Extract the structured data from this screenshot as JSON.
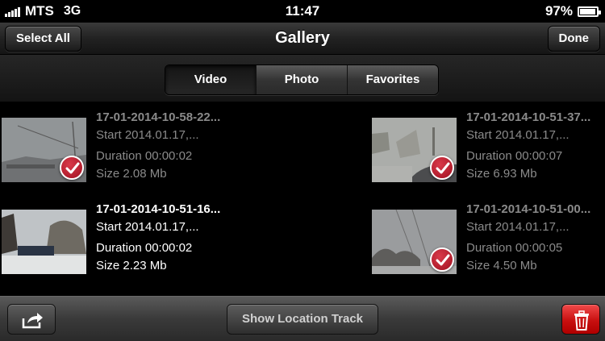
{
  "status_bar": {
    "carrier": "MTS",
    "network": "3G",
    "time": "11:47",
    "battery": "97%",
    "battery_level": 0.97
  },
  "nav": {
    "select_all_label": "Select All",
    "title": "Gallery",
    "done_label": "Done"
  },
  "tabs": [
    {
      "label": "Video",
      "active": true
    },
    {
      "label": "Photo",
      "active": false
    },
    {
      "label": "Favorites",
      "active": false
    }
  ],
  "videos": [
    {
      "title": "17-01-2014-10-58-22...",
      "start": "Start 2014.01.17,...",
      "duration": "Duration 00:00:02",
      "size": "Size 2.08 Mb",
      "checked": true
    },
    {
      "title": "17-01-2014-10-51-37...",
      "start": "Start 2014.01.17,...",
      "duration": "Duration 00:00:07",
      "size": "Size 6.93 Mb",
      "checked": true
    },
    {
      "title": "17-01-2014-10-51-16...",
      "start": "Start 2014.01.17,...",
      "duration": "Duration 00:00:02",
      "size": "Size 2.23 Mb",
      "checked": false
    },
    {
      "title": "17-01-2014-10-51-00...",
      "start": "Start 2014.01.17,...",
      "duration": "Duration 00:00:05",
      "size": "Size 4.50 Mb",
      "checked": true
    }
  ],
  "toolbar": {
    "location_track_label": "Show Location Track",
    "share_icon": "share-icon",
    "trash_icon": "trash-icon",
    "trash_color": "#d81818"
  },
  "colors": {
    "check_badge": "#b81c2c",
    "dim_text": "#8a8a8a"
  }
}
